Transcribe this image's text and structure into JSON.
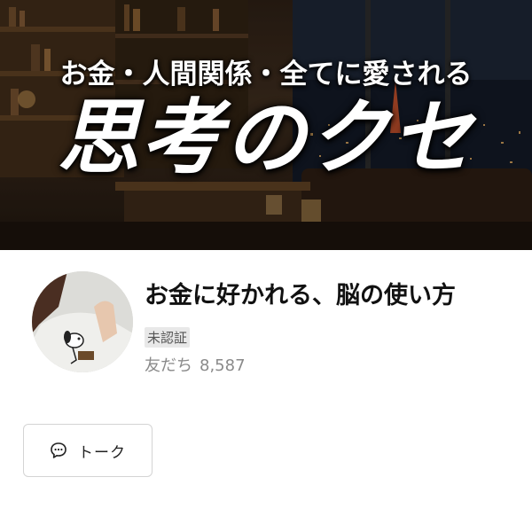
{
  "cover": {
    "subtitle": "お金・人間関係・全てに愛される",
    "title": "思考のクセ"
  },
  "profile": {
    "name": "お金に好かれる、脳の使い方",
    "status_badge": "未認証",
    "friends_label": "友だち",
    "friends_count": "8,587"
  },
  "actions": {
    "talk_label": "トーク",
    "talk_icon": "chat-bubble-icon"
  },
  "colors": {
    "text_primary": "#111111",
    "text_secondary": "#8a8a8a",
    "badge_bg": "#e8e8e8",
    "button_border": "#d4d4d4"
  }
}
